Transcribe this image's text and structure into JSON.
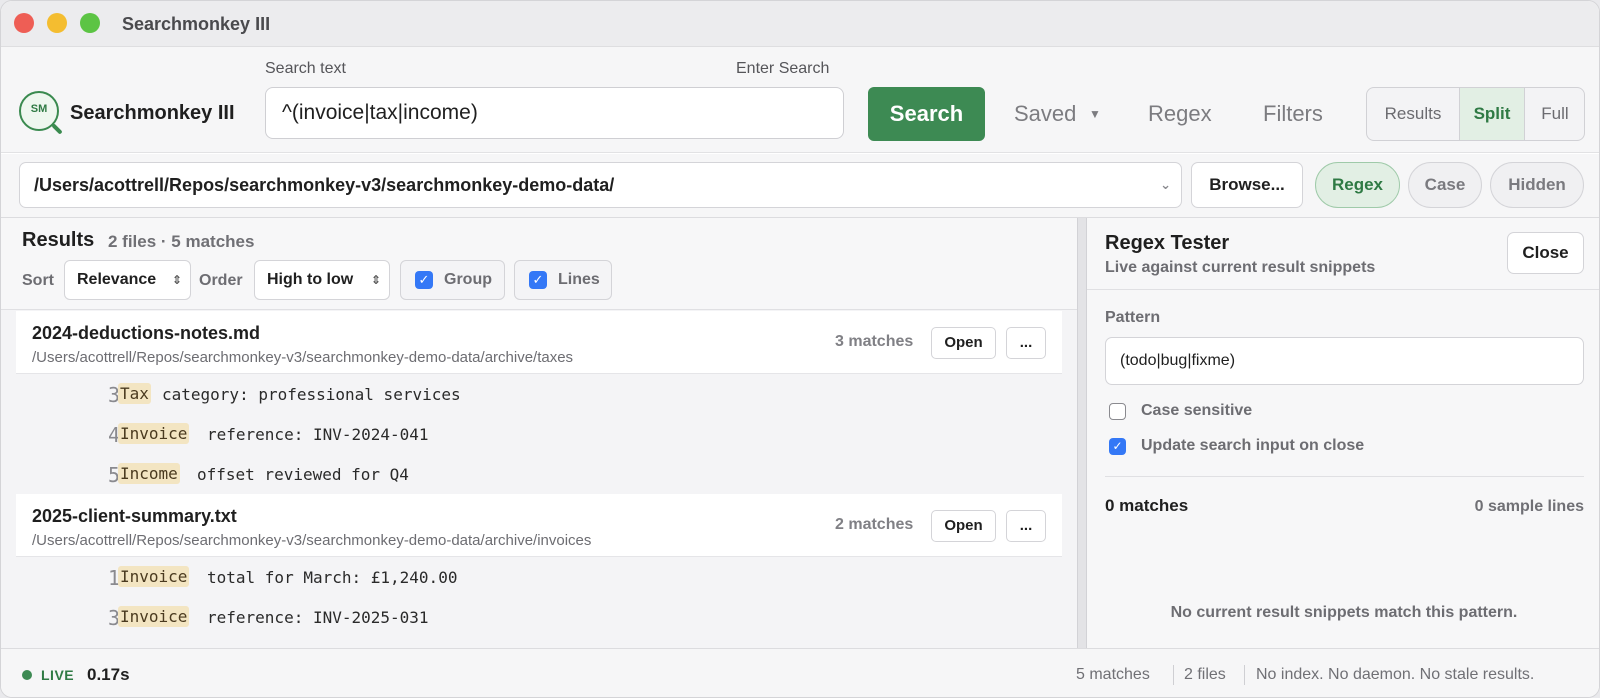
{
  "window": {
    "title": "Searchmonkey III"
  },
  "app": {
    "name": "Searchmonkey III",
    "logo_text": "SM"
  },
  "search": {
    "label": "Search text",
    "hint": "Enter Search",
    "value": "^(invoice|tax|income)",
    "button": "Search"
  },
  "toolbar": {
    "saved": "Saved",
    "regex": "Regex",
    "filters": "Filters",
    "view_modes": [
      "Results",
      "Split",
      "Full"
    ],
    "active_view": "Split"
  },
  "path": {
    "value": "/Users/acottrell/Repos/searchmonkey-v3/searchmonkey-demo-data/",
    "browse": "Browse...",
    "toggles": [
      "Regex",
      "Case",
      "Hidden"
    ],
    "active_toggle": "Regex"
  },
  "results": {
    "title": "Results",
    "summary": "2 files · 5 matches",
    "sort_label": "Sort",
    "sort_value": "Relevance",
    "order_label": "Order",
    "order_value": "High to low",
    "group_label": "Group",
    "group_checked": true,
    "lines_label": "Lines",
    "lines_checked": true,
    "files": [
      {
        "name": "2024-deductions-notes.md",
        "path": "/Users/acottrell/Repos/searchmonkey-v3/searchmonkey-demo-data/archive/taxes",
        "count": "3 matches",
        "open": "Open",
        "more": "...",
        "lines": [
          {
            "no": "3",
            "hit": "Tax",
            "rest": "category: professional services"
          },
          {
            "no": "4",
            "hit": "Invoice",
            "rest": "reference: INV-2024-041"
          },
          {
            "no": "5",
            "hit": "Income",
            "rest": "offset reviewed for Q4"
          }
        ]
      },
      {
        "name": "2025-client-summary.txt",
        "path": "/Users/acottrell/Repos/searchmonkey-v3/searchmonkey-demo-data/archive/invoices",
        "count": "2 matches",
        "open": "Open",
        "more": "...",
        "lines": [
          {
            "no": "1",
            "hit": "Invoice",
            "rest": "total for March: £1,240.00"
          },
          {
            "no": "3",
            "hit": "Invoice",
            "rest": "reference: INV-2025-031"
          }
        ]
      }
    ]
  },
  "regex_tester": {
    "title": "Regex Tester",
    "subtitle": "Live against current result snippets",
    "close": "Close",
    "pattern_label": "Pattern",
    "pattern_value": "(todo|bug|fixme)",
    "case_sensitive_label": "Case sensitive",
    "case_sensitive_checked": false,
    "update_label": "Update search input on close",
    "update_checked": true,
    "matches": "0 matches",
    "sample_lines": "0 sample lines",
    "empty_message": "No current result snippets match this pattern."
  },
  "status": {
    "live": "LIVE",
    "time": "0.17s",
    "matches": "5 matches",
    "files": "2 files",
    "note": "No index. No daemon. No stale results."
  },
  "colors": {
    "accent": "#3d8a53",
    "highlight": "#f3e5c2",
    "checkbox": "#3478f6"
  }
}
